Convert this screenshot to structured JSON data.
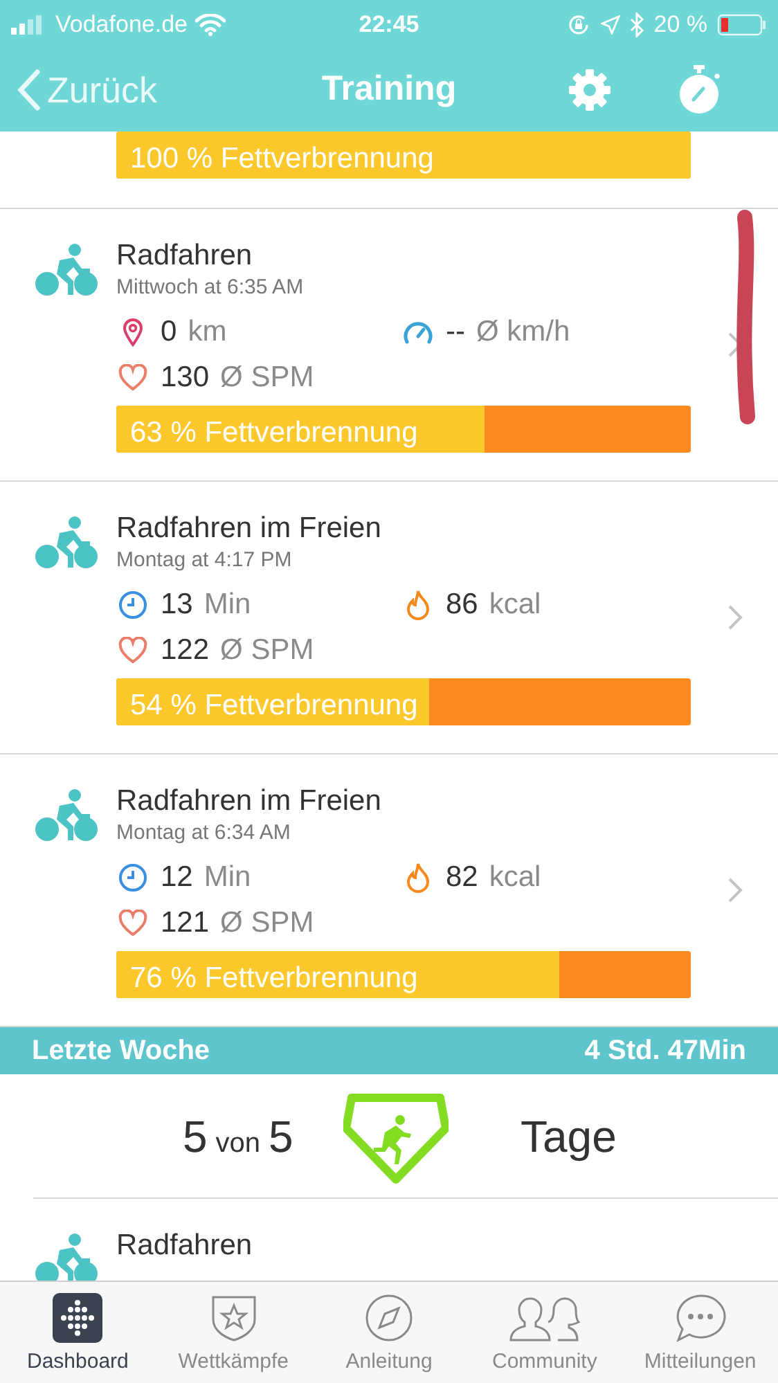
{
  "status_bar": {
    "carrier": "Vodafone.de",
    "time": "22:45",
    "battery": "20 %"
  },
  "nav": {
    "back": "Zurück",
    "title": "Training"
  },
  "top_bar": {
    "label": "100 % Fettverbrennung",
    "level": 1
  },
  "workouts": [
    {
      "title": "Radfahren",
      "subtitle": "Mittwoch at 6:35 AM",
      "stats": [
        {
          "kind": "distance",
          "value": "0",
          "unit": "km"
        },
        {
          "kind": "speed",
          "value": "--",
          "unit": "Ø km/h"
        },
        {
          "kind": "heart",
          "value": "130",
          "unit": "Ø SPM"
        }
      ],
      "bar": {
        "label": "63 % Fettverbrennung",
        "level": 0.64
      }
    },
    {
      "title": "Radfahren im Freien",
      "subtitle": "Montag at 4:17 PM",
      "stats": [
        {
          "kind": "time",
          "value": "13",
          "unit": "Min"
        },
        {
          "kind": "calories",
          "value": "86",
          "unit": "kcal"
        },
        {
          "kind": "heart",
          "value": "122",
          "unit": "Ø SPM"
        }
      ],
      "bar": {
        "label": "54 % Fettverbrennung",
        "level": 0.545
      }
    },
    {
      "title": "Radfahren im Freien",
      "subtitle": "Montag at 6:34 AM",
      "stats": [
        {
          "kind": "time",
          "value": "12",
          "unit": "Min"
        },
        {
          "kind": "calories",
          "value": "82",
          "unit": "kcal"
        },
        {
          "kind": "heart",
          "value": "121",
          "unit": "Ø SPM"
        }
      ],
      "bar": {
        "label": "76 % Fettverbrennung",
        "level": 0.77
      }
    }
  ],
  "week": {
    "title": "Letzte Woche",
    "total": "4 Std. 47Min",
    "done": "5",
    "von": "von",
    "goal": "5",
    "unit": "Tage"
  },
  "partial_workout": {
    "title": "Radfahren"
  },
  "tabs": [
    {
      "label": "Dashboard",
      "kind": "dashboard",
      "selected": true
    },
    {
      "label": "Wettkämpfe",
      "kind": "challenges",
      "selected": false
    },
    {
      "label": "Anleitung",
      "kind": "guide",
      "selected": false
    },
    {
      "label": "Community",
      "kind": "community",
      "selected": false
    },
    {
      "label": "Mitteilungen",
      "kind": "messages",
      "selected": false
    }
  ]
}
